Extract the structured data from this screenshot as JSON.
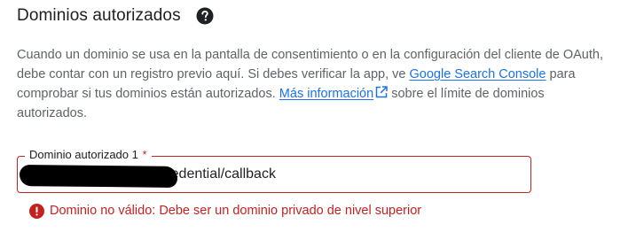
{
  "section": {
    "title": "Dominios autorizados",
    "help_icon": "help-circle-icon"
  },
  "description": {
    "text_1": "Cuando un dominio se usa en la pantalla de consentimiento o en la configuración del cliente de OAuth, debe contar con un registro previo aquí. Si debes verificar la app, ve ",
    "link_search_console": "Google Search Console",
    "text_2": " para comprobar si tus dominios están autorizados. ",
    "link_more_info": "Más información",
    "external_icon": "open-in-new-icon",
    "text_3": " sobre el límite de dominios autorizados."
  },
  "field": {
    "label": "Dominio autorizado 1",
    "required_marker": "*",
    "value": "y.com/rest/oauth2-credential/callback"
  },
  "error": {
    "icon": "error-icon",
    "message": "Dominio no válido: Debe ser un dominio privado de nivel superior"
  },
  "colors": {
    "link": "#1a73e8",
    "error": "#c5221f",
    "title": "#202124",
    "body_text": "#5f6368"
  }
}
